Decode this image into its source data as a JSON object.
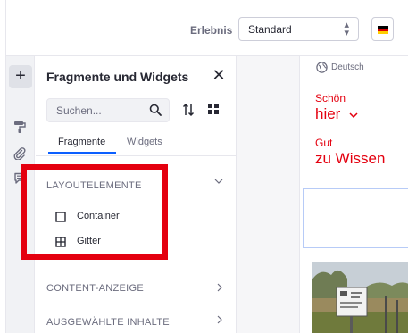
{
  "toolbar": {
    "experience_label": "Erlebnis",
    "experience_value": "Standard",
    "language_flag_colors": [
      "#000000",
      "#dd0000",
      "#ffce00"
    ]
  },
  "rail": {
    "add_icon": "plus-icon",
    "tools": [
      "paint-roller-icon",
      "paperclip-icon",
      "comment-icon"
    ]
  },
  "panel": {
    "title": "Fragmente und Widgets",
    "search_placeholder": "Suchen...",
    "tabs": [
      {
        "label": "Fragmente",
        "active": true
      },
      {
        "label": "Widgets",
        "active": false
      }
    ],
    "sections": [
      {
        "title": "LAYOUTELEMENTE",
        "expanded": true,
        "items": [
          {
            "label": "Container",
            "icon": "square-icon"
          },
          {
            "label": "Gitter",
            "icon": "grid-table-icon"
          }
        ]
      },
      {
        "title": "CONTENT-ANZEIGE",
        "expanded": false
      },
      {
        "title": "AUSGEWÄHLTE INHALTE",
        "expanded": false
      }
    ]
  },
  "highlight_color": "#e4000f",
  "preview": {
    "language": "Deutsch",
    "nav1_small": "Schön",
    "nav1_big": "hier",
    "nav2_small": "Gut",
    "nav2_big": "zu Wissen",
    "accent": "#e4000f"
  }
}
